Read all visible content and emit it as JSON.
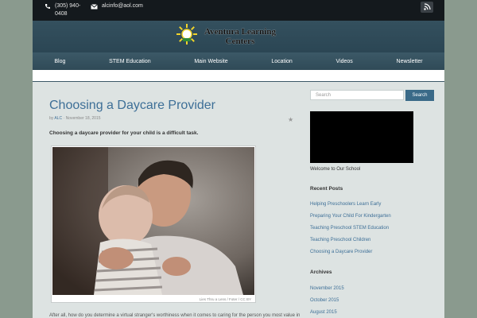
{
  "topbar": {
    "phone": "(305) 940-0408",
    "email": "alcinfo@aol.com",
    "icons": {
      "phone": "phone-icon",
      "email": "envelope-icon",
      "rss": "rss-icon"
    }
  },
  "header": {
    "logo_text": "Aventura Learning Centers",
    "logo_icon": "sun-icon"
  },
  "nav": {
    "items": [
      "Blog",
      "STEM Education",
      "Main Website",
      "Location",
      "Videos",
      "Newsletter"
    ]
  },
  "post": {
    "title": "Choosing a Daycare Provider",
    "by": "by",
    "author": "ALC",
    "separator": "·",
    "date": "November 18, 2015",
    "lead": "Choosing a daycare provider for your child is a difficult task.",
    "photo_caption": "Lies Thru a Lens / Foter / CC BY",
    "body_start": "After all, how do you determine a virtual stranger's worthiness when it comes to caring for the person you most value in"
  },
  "sidebar": {
    "search_placeholder": "Search",
    "search_button": "Search",
    "video_caption": "Welcome to Our School",
    "recent_title": "Recent Posts",
    "recent": [
      "Helping Preschoolers Learn Early",
      "Preparing Your Child For Kindergarten",
      "Teaching Preschool STEM Education",
      "Teaching Preschool Children",
      "Choosing a Daycare Provider"
    ],
    "archives_title": "Archives",
    "archives": [
      "November 2015",
      "October 2015",
      "August 2015"
    ]
  },
  "colors": {
    "accent": "#3d6f97",
    "header": "#2b4654",
    "topbar": "#14191d",
    "background": "#8a9a8e"
  }
}
